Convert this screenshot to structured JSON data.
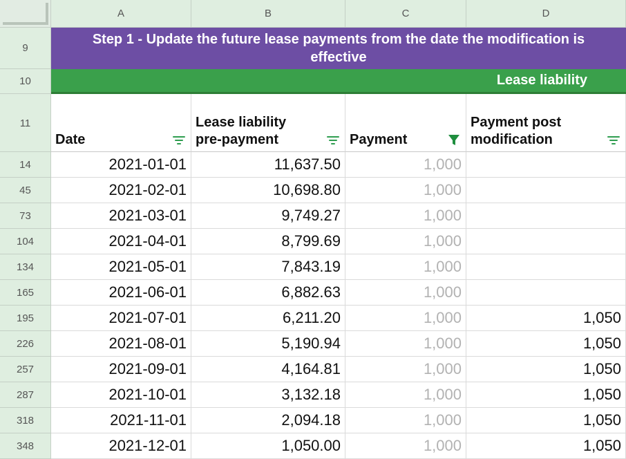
{
  "columns": [
    "A",
    "B",
    "C",
    "D"
  ],
  "banner": {
    "row": "9",
    "text": "Step 1 - Update the future lease payments from the date the modification is effective"
  },
  "section": {
    "row": "10",
    "text": "Lease liability"
  },
  "header_row": "11",
  "headers": [
    "Date",
    "Lease liability\npre-payment",
    "Payment",
    "Payment post\nmodification"
  ],
  "filter_icons": [
    "filter-lines-icon",
    "filter-lines-icon",
    "filter-funnel-active-icon",
    "filter-lines-icon"
  ],
  "colors": {
    "banner": "#6d4ea4",
    "section": "#3aa04b",
    "filter_active": "#1e8e3e",
    "filter": "#2e9d4f"
  },
  "rows": [
    {
      "num": "14",
      "date": "2021-01-01",
      "liability": "11,637.50",
      "payment": "1,000",
      "post": ""
    },
    {
      "num": "45",
      "date": "2021-02-01",
      "liability": "10,698.80",
      "payment": "1,000",
      "post": ""
    },
    {
      "num": "73",
      "date": "2021-03-01",
      "liability": "9,749.27",
      "payment": "1,000",
      "post": ""
    },
    {
      "num": "104",
      "date": "2021-04-01",
      "liability": "8,799.69",
      "payment": "1,000",
      "post": ""
    },
    {
      "num": "134",
      "date": "2021-05-01",
      "liability": "7,843.19",
      "payment": "1,000",
      "post": ""
    },
    {
      "num": "165",
      "date": "2021-06-01",
      "liability": "6,882.63",
      "payment": "1,000",
      "post": ""
    },
    {
      "num": "195",
      "date": "2021-07-01",
      "liability": "6,211.20",
      "payment": "1,000",
      "post": "1,050"
    },
    {
      "num": "226",
      "date": "2021-08-01",
      "liability": "5,190.94",
      "payment": "1,000",
      "post": "1,050"
    },
    {
      "num": "257",
      "date": "2021-09-01",
      "liability": "4,164.81",
      "payment": "1,000",
      "post": "1,050"
    },
    {
      "num": "287",
      "date": "2021-10-01",
      "liability": "3,132.18",
      "payment": "1,000",
      "post": "1,050"
    },
    {
      "num": "318",
      "date": "2021-11-01",
      "liability": "2,094.18",
      "payment": "1,000",
      "post": "1,050"
    },
    {
      "num": "348",
      "date": "2021-12-01",
      "liability": "1,050.00",
      "payment": "1,000",
      "post": "1,050"
    }
  ]
}
